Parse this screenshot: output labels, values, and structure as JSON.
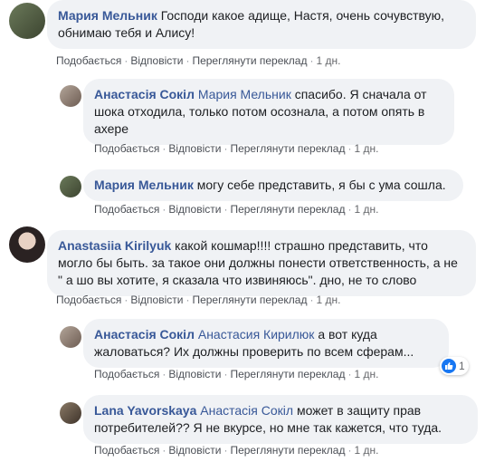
{
  "actions": {
    "like": "Подобається",
    "reply": "Відповісти",
    "translate": "Переглянути переклад",
    "time": "1 дн."
  },
  "comments": [
    {
      "author": "Мария Мельник",
      "text": "Господи какое адище, Настя, очень сочувствую, обнимаю тебя и Алису!"
    },
    {
      "author": "Анастасія Сокіл",
      "mention": "Мария Мельник",
      "text": "спасибо. Я сначала от шока отходила, только потом осознала, а потом опять в ахере"
    },
    {
      "author": "Мария Мельник",
      "text": "могу себе представить, я бы с ума сошла."
    },
    {
      "author": "Anastasiia Kirilyuk",
      "text": "какой кошмар!!!! страшно представить, что могло бы быть. за такое они должны понести ответственность, а не \" а шо вы хотите, я сказала что извиняюсь\". дно, не то слово"
    },
    {
      "author": "Анастасія Сокіл",
      "mention": "Анастасия Кирилюк",
      "text": "а вот куда жаловаться? Их должны проверить по всем сферам...",
      "reaction_count": "1"
    },
    {
      "author": "Lana Yavorskaya",
      "mention": "Анастасія Сокіл",
      "text": "может в защиту прав потребителей?? Я не вкурсе, но мне так кажется, что туда."
    }
  ],
  "colors": {
    "link": "#385898",
    "bubble": "#f0f2f5",
    "meta": "#65676b",
    "like": "#1877f2"
  }
}
